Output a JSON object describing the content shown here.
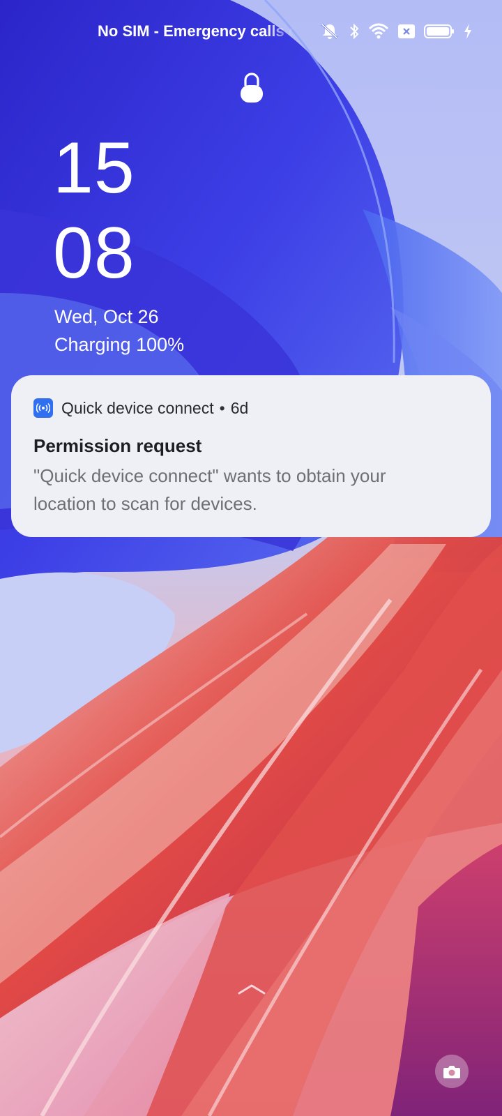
{
  "status_bar": {
    "carrier_text": "No SIM - Emergency calls only",
    "icons": [
      "bell-muted-icon",
      "bluetooth-icon",
      "wifi-icon",
      "no-sim-icon",
      "battery-icon",
      "charging-bolt-icon"
    ]
  },
  "lockscreen": {
    "hour": "15",
    "minute": "08",
    "date": "Wed, Oct 26",
    "charging": "Charging 100%"
  },
  "notification": {
    "app_name": "Quick device connect",
    "separator": "•",
    "age": "6d",
    "title": "Permission request",
    "body": "\"Quick device connect\" wants to obtain your location to scan for devices.",
    "app_icon": "radio-signal-icon",
    "app_icon_color": "#2f6ff0"
  },
  "bottom": {
    "swipe_hint_icon": "chevron-up-icon",
    "camera_icon": "camera-icon"
  },
  "colors": {
    "wallpaper_blue": "#3b3fe0",
    "wallpaper_red": "#e0453f",
    "wallpaper_pink": "#e8a9c8",
    "card_background": "#eef0f5"
  }
}
